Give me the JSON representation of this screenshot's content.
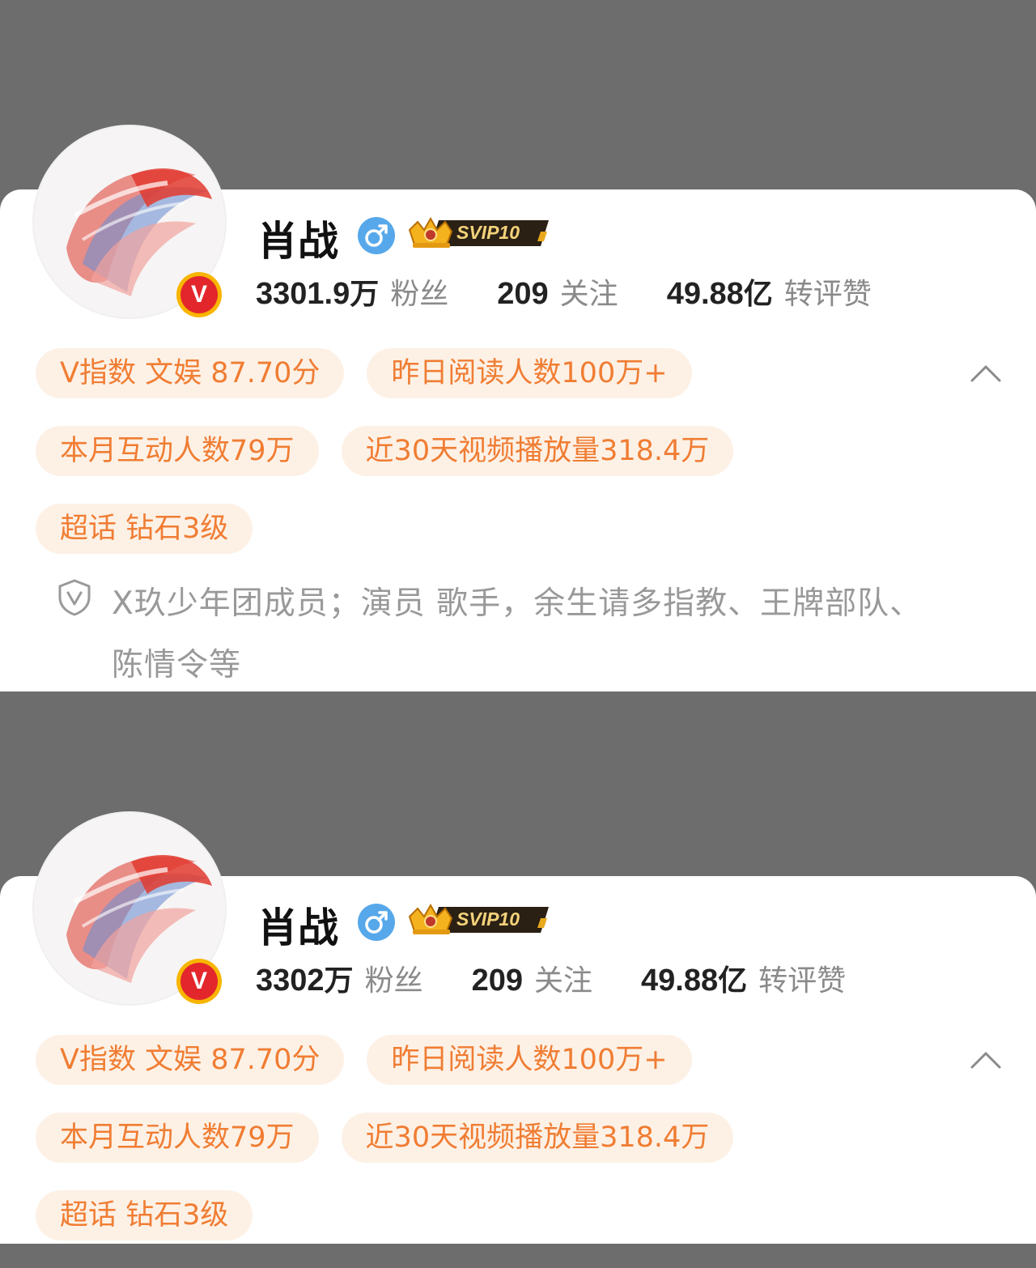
{
  "panels": [
    {
      "name": "肖战",
      "svip_label": "SVIP10",
      "stats": {
        "fans_num": "3301.9",
        "fans_unit": "万",
        "fans_label": "粉丝",
        "following_num": "209",
        "following_label": "关注",
        "interactions_num": "49.88",
        "interactions_unit": "亿",
        "interactions_label": "转评赞"
      },
      "tags": {
        "v_index": "V指数 文娱 87.70分",
        "yesterday_readers": "昨日阅读人数100万+",
        "monthly_interactions": "本月互动人数79万",
        "video_plays": "近30天视频播放量318.4万",
        "super_topic": "超话 钻石3级"
      },
      "bio": "X玖少年团成员；演员 歌手，余生请多指教、王牌部队、陈情令等"
    },
    {
      "name": "肖战",
      "svip_label": "SVIP10",
      "stats": {
        "fans_num": "3302",
        "fans_unit": "万",
        "fans_label": "粉丝",
        "following_num": "209",
        "following_label": "关注",
        "interactions_num": "49.88",
        "interactions_unit": "亿",
        "interactions_label": "转评赞"
      },
      "tags": {
        "v_index": "V指数 文娱 87.70分",
        "yesterday_readers": "昨日阅读人数100万+",
        "monthly_interactions": "本月互动人数79万",
        "video_plays": "近30天视频播放量318.4万",
        "super_topic": "超话 钻石3级"
      }
    }
  ],
  "colors": {
    "background": "#6d6d6d",
    "card": "#ffffff",
    "tag_bg": "#fdf1e6",
    "tag_text": "#f07d33",
    "verified_badge": "#e3262c",
    "gender_blue": "#56a8ea"
  },
  "icons": {
    "verified": "verified-v-icon",
    "gender": "male-gender-icon",
    "svip": "svip-crown-icon",
    "collapse": "chevron-up-icon",
    "bio": "shield-v-icon"
  }
}
